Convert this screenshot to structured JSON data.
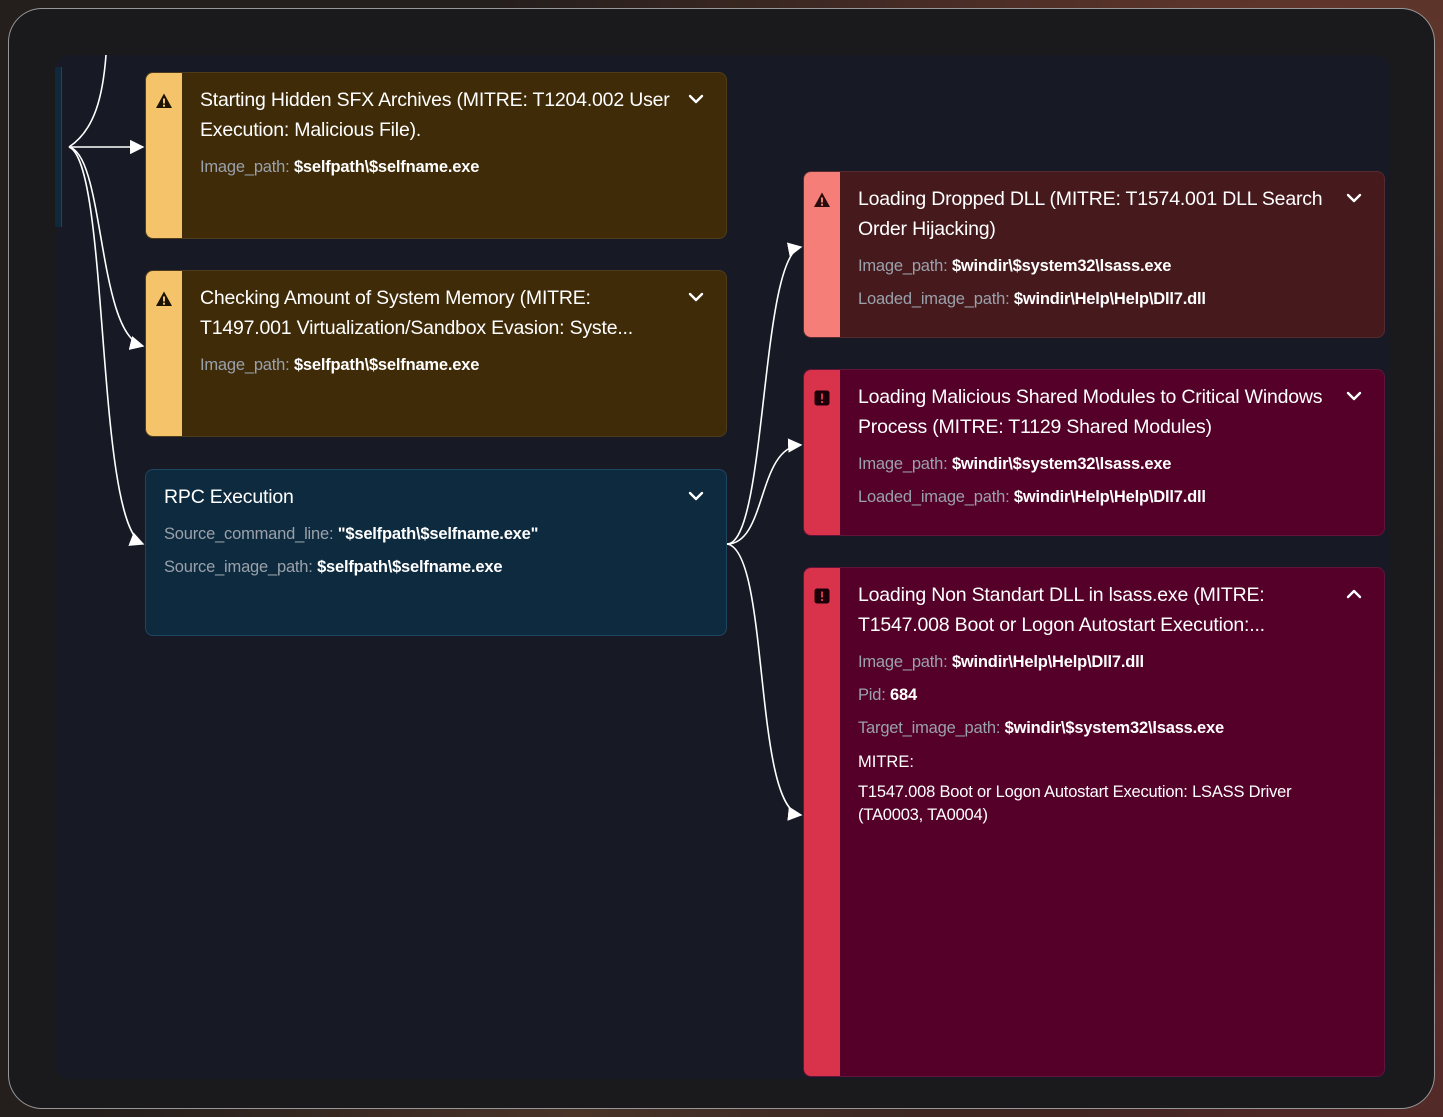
{
  "colors": {
    "amber_bg": "#3f2b08",
    "amber_stripe": "#f5c36a",
    "rpc_bg": "#0d2a3e",
    "salmon_bg": "#461a1d",
    "salmon_stripe": "#f57f78",
    "crimson_bg": "#540028",
    "crimson_stripe": "#d8334a",
    "edge": "#ffffff"
  },
  "cards": {
    "sfx": {
      "severity": "warning",
      "icon": "warning-triangle-icon",
      "title": "Starting Hidden SFX Archives (MITRE: T1204.002 User Execution: Malicious File).",
      "fields": [
        {
          "key": "Image_path:",
          "value": "$selfpath\\$selfname.exe"
        }
      ],
      "chevron": "chevron-down-icon"
    },
    "memory": {
      "severity": "warning",
      "icon": "warning-triangle-icon",
      "title_line1": "Checking Amount of System Memory (MITRE:",
      "title_line2": "T1497.001 Virtualization/Sandbox Evasion: Syste...",
      "fields": [
        {
          "key": "Image_path:",
          "value": "$selfpath\\$selfname.exe"
        }
      ],
      "chevron": "chevron-down-icon"
    },
    "rpc": {
      "title": "RPC Execution",
      "fields": [
        {
          "key": "Source_command_line:",
          "value": "\"$selfpath\\$selfname.exe\""
        },
        {
          "key": "Source_image_path:",
          "value": "$selfpath\\$selfname.exe"
        }
      ],
      "chevron": "chevron-down-icon"
    },
    "dropped_dll": {
      "severity": "warning",
      "icon": "warning-triangle-icon",
      "title": "Loading Dropped DLL (MITRE: T1574.001 DLL Search Order Hijacking)",
      "fields": [
        {
          "key": "Image_path:",
          "value": "$windir\\$system32\\lsass.exe"
        },
        {
          "key": "Loaded_image_path:",
          "value": "$windir\\Help\\Help\\Dll7.dll"
        }
      ],
      "chevron": "chevron-down-icon"
    },
    "shared_modules": {
      "severity": "critical",
      "icon": "alert-square-icon",
      "title": "Loading Malicious Shared Modules to Critical Windows Process (MITRE: T1129 Shared Modules)",
      "fields": [
        {
          "key": "Image_path:",
          "value": "$windir\\$system32\\lsass.exe"
        },
        {
          "key": "Loaded_image_path:",
          "value": "$windir\\Help\\Help\\Dll7.dll"
        }
      ],
      "chevron": "chevron-down-icon"
    },
    "non_standard_dll": {
      "severity": "critical",
      "icon": "alert-square-icon",
      "title_line1": "Loading Non Standart DLL in lsass.exe (MITRE:",
      "title_line2": "T1547.008 Boot or Logon Autostart Execution:...",
      "fields": [
        {
          "key": "Image_path:",
          "value": "$windir\\Help\\Help\\Dll7.dll"
        },
        {
          "key": "Pid:",
          "value": "684"
        },
        {
          "key": "Target_image_path:",
          "value": "$windir\\$system32\\lsass.exe"
        }
      ],
      "mitre_label": "MITRE:",
      "mitre_text": "T1547.008 Boot or Logon Autostart Execution: LSASS Driver (TA0003, TA0004)",
      "chevron": "chevron-up-icon"
    }
  }
}
